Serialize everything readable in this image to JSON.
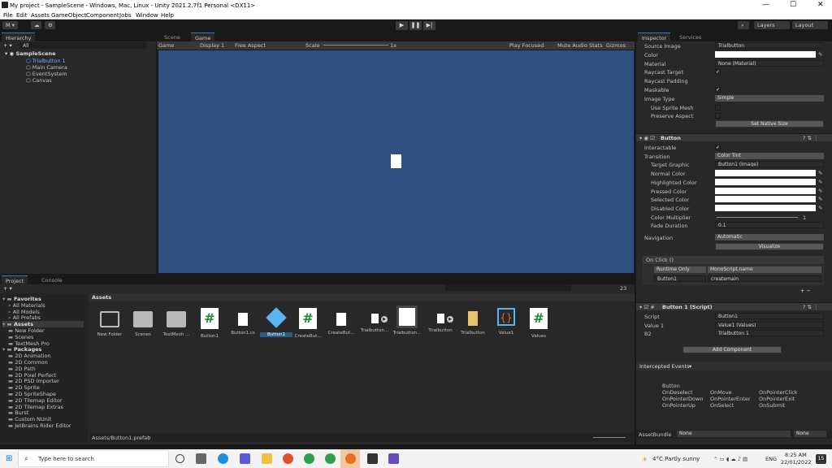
{
  "window": {
    "title": "My project - SampleScene - Windows, Mac, Linux - Unity 2021.2.7f1 Personal <DX11>",
    "min": "—",
    "max": "☐",
    "close": "✕"
  },
  "menu": [
    "File",
    "Edit",
    "Assets",
    "GameObject",
    "Component",
    "Jobs",
    "Window",
    "Help"
  ],
  "toolbar": {
    "account": "M ▾",
    "layers": "Layers",
    "layout": "Layout"
  },
  "hierarchy": {
    "tab": "Hierarchy",
    "search": "All",
    "scene": "SampleScene",
    "items": [
      "Trialbutton 1",
      "Main Camera",
      "EventSystem",
      "Canvas"
    ]
  },
  "scene_tabs": {
    "scene": "Scene",
    "game": "Game"
  },
  "game_bar": {
    "game": "Game",
    "display": "Display 1",
    "aspect": "Free Aspect",
    "scale": "Scale",
    "scale_val": "1x",
    "play_focused": "Play Focused",
    "mute": "Mute Audio",
    "stats": "Stats",
    "gizmos": "Gizmos"
  },
  "project": {
    "tab": "Project",
    "console": "Console",
    "badge": "23",
    "breadcrumb": "Assets",
    "path": "Assets/Button1.prefab",
    "tree": [
      {
        "t": "Favorites",
        "b": true
      },
      {
        "t": "All Materials"
      },
      {
        "t": "All Models"
      },
      {
        "t": "All Prefabs"
      },
      {
        "t": "Assets",
        "b": true
      },
      {
        "t": "New Folder"
      },
      {
        "t": "Scenes"
      },
      {
        "t": "TextMesh Pro"
      },
      {
        "t": "Packages",
        "b": true
      },
      {
        "t": "2D Animation"
      },
      {
        "t": "2D Common"
      },
      {
        "t": "2D Path"
      },
      {
        "t": "2D Pixel Perfect"
      },
      {
        "t": "2D PSD Importer"
      },
      {
        "t": "2D Sprite"
      },
      {
        "t": "2D SpriteShape"
      },
      {
        "t": "2D Tilemap Editor"
      },
      {
        "t": "2D Tilemap Extras"
      },
      {
        "t": "Burst"
      },
      {
        "t": "Custom NUnit"
      },
      {
        "t": "JetBrains Rider Editor"
      }
    ],
    "assets": [
      {
        "n": "New Folder",
        "k": "folder-outline"
      },
      {
        "n": "Scenes",
        "k": "folder"
      },
      {
        "n": "TextMesh ...",
        "k": "folder"
      },
      {
        "n": "Button1",
        "k": "script"
      },
      {
        "n": "Button1.cs",
        "k": "file"
      },
      {
        "n": "Button1",
        "k": "cube",
        "sel": true
      },
      {
        "n": "CreateBut...",
        "k": "script"
      },
      {
        "n": "CreateBut...",
        "k": "file"
      },
      {
        "n": "Trialbutton...",
        "k": "sprite"
      },
      {
        "n": "Trialbutton...",
        "k": "white"
      },
      {
        "n": "Trialbutton",
        "k": "sprite"
      },
      {
        "n": "Trialbutton",
        "k": "zip"
      },
      {
        "n": "Value1",
        "k": "cubebrace"
      },
      {
        "n": "Values",
        "k": "script"
      }
    ]
  },
  "inspector": {
    "tab": "Inspector",
    "services": "Services",
    "image": [
      {
        "l": "Source Image",
        "v": "Trialbutton"
      },
      {
        "l": "Color",
        "v": ""
      },
      {
        "l": "Material",
        "v": "None (Material)"
      },
      {
        "l": "Raycast Target",
        "v": "✓"
      },
      {
        "l": "Raycast Padding",
        "v": ""
      },
      {
        "l": "Maskable",
        "v": "✓"
      },
      {
        "l": "Image Type",
        "v": "Simple"
      },
      {
        "l": "Use Sprite Mesh",
        "v": ""
      },
      {
        "l": "Preserve Aspect",
        "v": ""
      }
    ],
    "native": "Set Native Size",
    "button_title": "Button",
    "button": [
      {
        "l": "Interactable",
        "v": "✓"
      },
      {
        "l": "Transition",
        "v": "Color Tint"
      },
      {
        "l": "Target Graphic",
        "v": "Button1 (Image)"
      },
      {
        "l": "Normal Color",
        "v": ""
      },
      {
        "l": "Highlighted Color",
        "v": ""
      },
      {
        "l": "Pressed Color",
        "v": ""
      },
      {
        "l": "Selected Color",
        "v": ""
      },
      {
        "l": "Disabled Color",
        "v": ""
      },
      {
        "l": "Color Multiplier",
        "v": "1"
      },
      {
        "l": "Fade Duration",
        "v": "0.1"
      }
    ],
    "navigation": "Navigation",
    "nav_val": "Automatic",
    "visualize": "Visualize",
    "onclick": "On Click ()",
    "runtime": "Runtime Only",
    "method": "MonoScript.name",
    "obj": "Button1",
    "arg": "createmain",
    "script_title": "Button 1 (Script)",
    "script_fields": [
      {
        "l": "Script",
        "v": "Button1"
      },
      {
        "l": "Value 1",
        "v": "Value1 (Values)"
      },
      {
        "l": "B2",
        "v": "Trialbutton 1"
      }
    ],
    "add_component": "Add Component",
    "intercepted": "Intercepted Events",
    "events_header": "Button",
    "events": [
      [
        "OnDeselect",
        "OnMove",
        "OnPointerClick"
      ],
      [
        "OnPointerDown",
        "OnPointerEnter",
        "OnPointerExit"
      ],
      [
        "OnPointerUp",
        "OnSelect",
        "OnSubmit"
      ]
    ],
    "assetbundle": "AssetBundle",
    "ab1": "None",
    "ab2": "None"
  },
  "taskbar": {
    "search": "Type here to search",
    "weather": "4°C Partly sunny",
    "lang": "ENG",
    "time": "8:25 AM",
    "date": "22/01/2022",
    "notif": "15"
  },
  "colors": {
    "game_bg": "#2f4f7e",
    "accent": "#3a79bb"
  }
}
